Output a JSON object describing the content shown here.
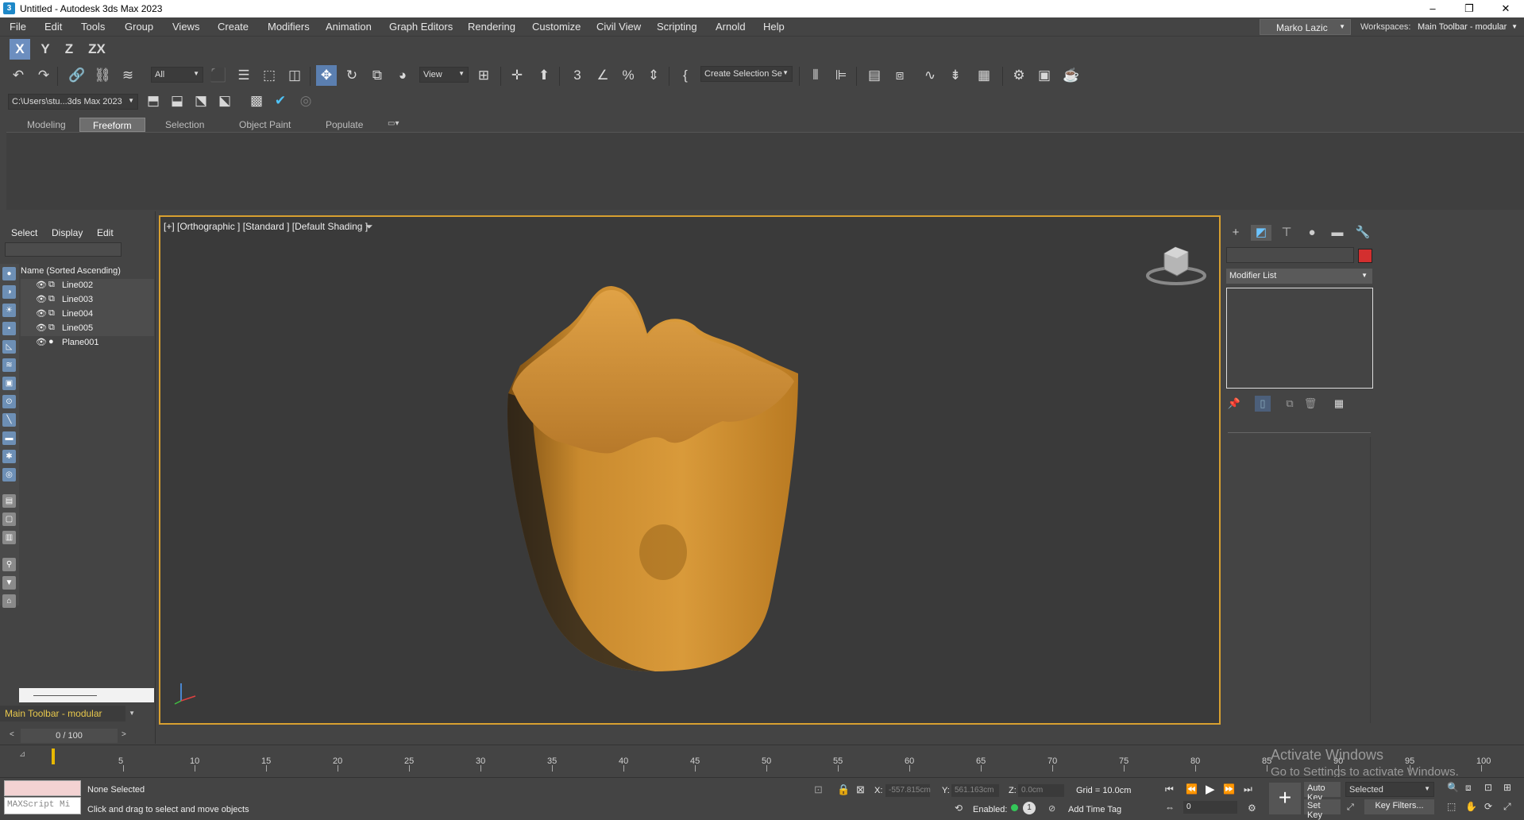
{
  "window": {
    "title": "Untitled - Autodesk 3ds Max 2023",
    "controls": [
      "–",
      "❐",
      "✕"
    ]
  },
  "menu": [
    "File",
    "Edit",
    "Tools",
    "Group",
    "Views",
    "Create",
    "Modifiers",
    "Animation",
    "Graph Editors",
    "Rendering",
    "Customize",
    "Civil View",
    "Scripting",
    "Arnold",
    "Help"
  ],
  "user": {
    "name": "Marko Lazic"
  },
  "workspaces": {
    "label": "Workspaces:",
    "value": "Main Toolbar - modular"
  },
  "toolbar": {
    "axis_constraints": [
      "X",
      "Y",
      "Z",
      "ZX"
    ],
    "selection_filter": "All",
    "ref_coord": "View",
    "named_selection": "Create Selection Se",
    "project_path": "C:\\Users\\stu...3ds Max 2023"
  },
  "ribbon": {
    "tabs": [
      "Modeling",
      "Freeform",
      "Selection",
      "Object Paint",
      "Populate"
    ],
    "active_tab": "Freeform"
  },
  "scene_explorer": {
    "menu": [
      "Select",
      "Display",
      "Edit"
    ],
    "column_header": "Name (Sorted Ascending)",
    "objects": [
      {
        "name": "Line002",
        "type": "shape"
      },
      {
        "name": "Line003",
        "type": "shape"
      },
      {
        "name": "Line004",
        "type": "shape"
      },
      {
        "name": "Line005",
        "type": "shape"
      },
      {
        "name": "Plane001",
        "type": "geometry"
      }
    ],
    "workspace_dropdown": "Main Toolbar - modular"
  },
  "viewport": {
    "label": "[+] [Orthographic ] [Standard ] [Default Shading ]",
    "object_color": "#c98a2e",
    "border_color": "#d8a030"
  },
  "command_panel": {
    "modifier_list": "Modifier List",
    "object_color": "#d32f2f"
  },
  "timeline": {
    "frame_display": "0 / 100",
    "current_frame": 0,
    "ticks": [
      5,
      10,
      15,
      20,
      25,
      30,
      35,
      40,
      45,
      50,
      55,
      60,
      65,
      70,
      75,
      80,
      85,
      90,
      95,
      100
    ]
  },
  "status": {
    "selection": "None Selected",
    "prompt": "Click and drag to select and move objects",
    "maxscript_placeholder": "MAXScript Mi",
    "x_label": "X:",
    "x": "-557.815cm",
    "y_label": "Y:",
    "y": "561.163cm",
    "z_label": "Z:",
    "z": "0.0cm",
    "grid": "Grid = 10.0cm",
    "enabled_label": "Enabled:",
    "add_time_tag": "Add Time Tag",
    "auto_key": "Auto Key",
    "set_key": "Set Key",
    "key_mode": "Selected",
    "key_filters": "Key Filters...",
    "frame_input": "0"
  },
  "watermark": {
    "title": "Activate Windows",
    "subtitle": "Go to Settings to activate Windows."
  }
}
